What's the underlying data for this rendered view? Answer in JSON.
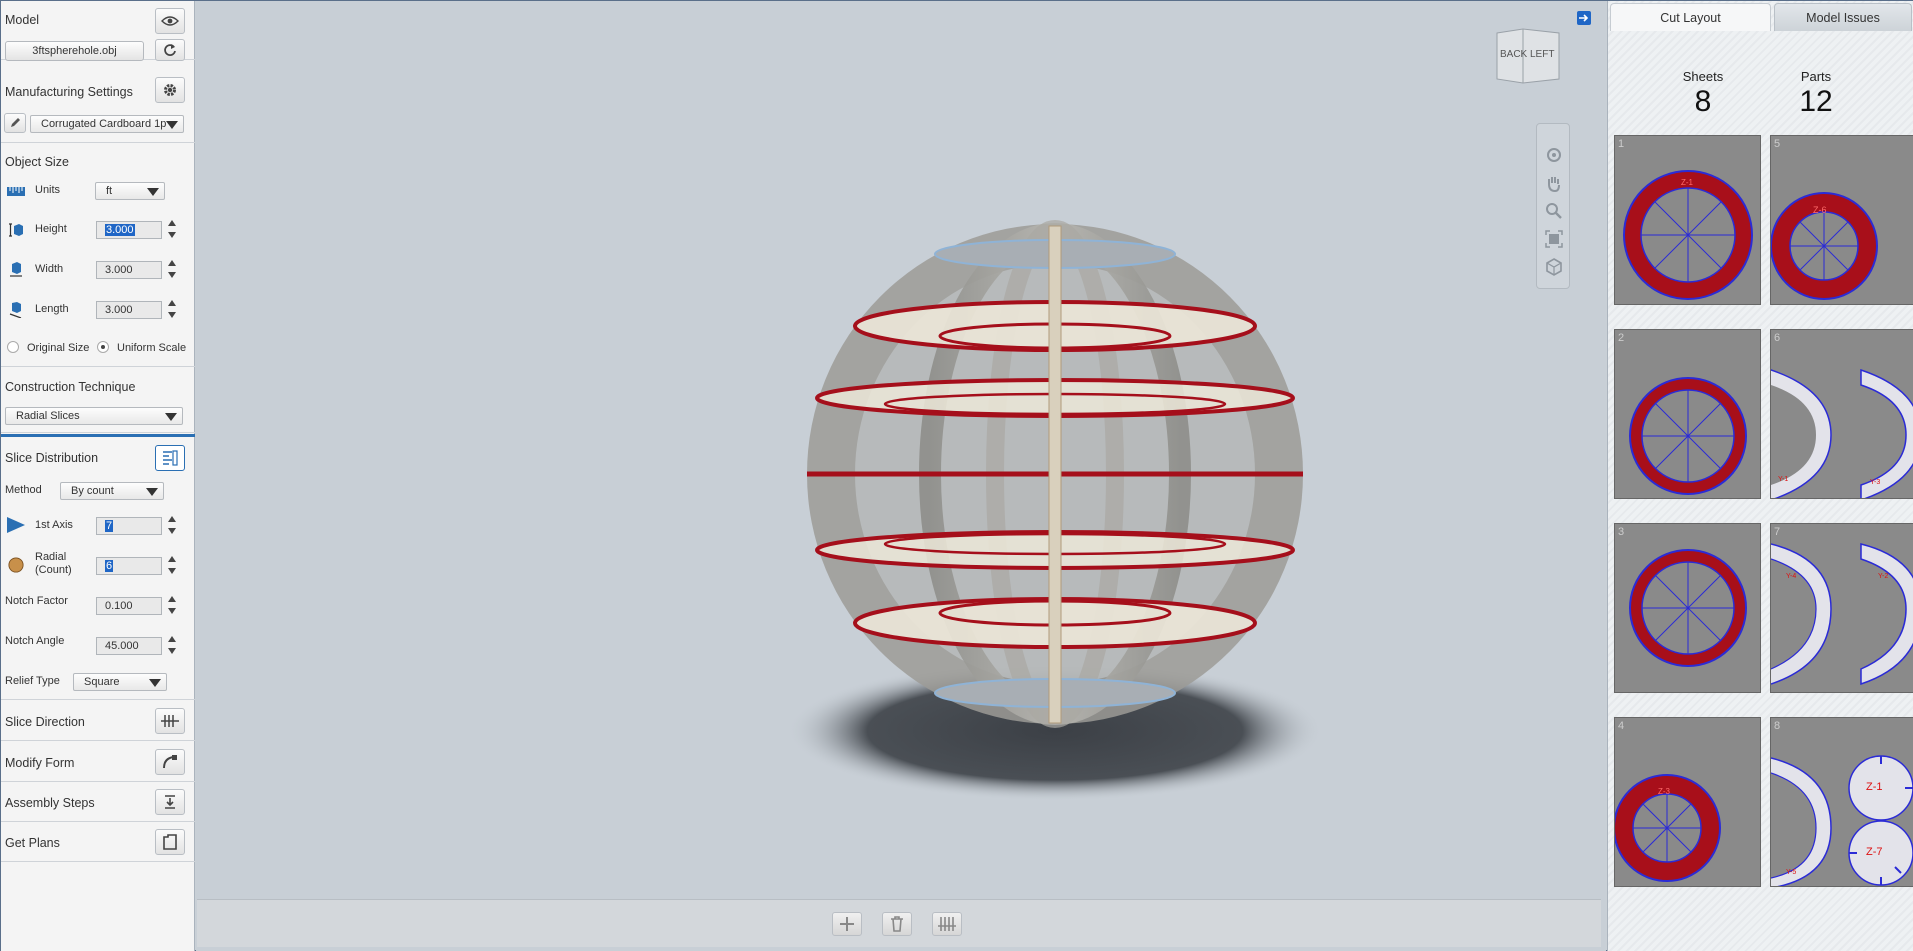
{
  "left_panel": {
    "model": {
      "title": "Model",
      "file_name": "3ftspherehole.obj"
    },
    "manufacturing": {
      "title": "Manufacturing Settings",
      "material": "Corrugated Cardboard 1p"
    },
    "object_size": {
      "title": "Object Size",
      "units_label": "Units",
      "units_value": "ft",
      "height_label": "Height",
      "height_value": "3.000",
      "width_label": "Width",
      "width_value": "3.000",
      "length_label": "Length",
      "length_value": "3.000",
      "original_size_label": "Original Size",
      "uniform_scale_label": "Uniform Scale"
    },
    "construction": {
      "title": "Construction Technique",
      "technique": "Radial Slices"
    },
    "slice_distribution": {
      "title": "Slice Distribution",
      "method_label": "Method",
      "method_value": "By count",
      "first_axis_label": "1st Axis",
      "first_axis_value": "7",
      "radial_label_1": "Radial",
      "radial_label_2": "(Count)",
      "radial_value": "6",
      "notch_factor_label": "Notch Factor",
      "notch_factor_value": "0.100",
      "notch_angle_label": "Notch Angle",
      "notch_angle_value": "45.000",
      "relief_type_label": "Relief Type",
      "relief_type_value": "Square"
    },
    "slice_direction": {
      "title": "Slice Direction"
    },
    "modify_form": {
      "title": "Modify Form"
    },
    "assembly_steps": {
      "title": "Assembly Steps"
    },
    "get_plans": {
      "title": "Get Plans"
    }
  },
  "view_cube": {
    "back": "BACK",
    "left": "LEFT"
  },
  "right_panel": {
    "tabs": [
      {
        "label": "Cut Layout",
        "active": true
      },
      {
        "label": "Model Issues",
        "active": false
      }
    ],
    "sheets_label": "Sheets",
    "sheets_value": "8",
    "parts_label": "Parts",
    "parts_value": "12",
    "sheet_numbers": [
      "1",
      "5",
      "2",
      "6",
      "3",
      "7",
      "4",
      "8"
    ],
    "part_labels": [
      "Z-1",
      "Z-6",
      "Y-1",
      "Y-3",
      "Y-4",
      "Y-2",
      "Z-3",
      "Z-1",
      "Z-7",
      "Y-5"
    ]
  },
  "colors": {
    "accent": "#1f66c6",
    "part_red": "#a80f1a",
    "part_outline": "#2b2bd6",
    "sheet_gray": "#8a8a8a"
  }
}
